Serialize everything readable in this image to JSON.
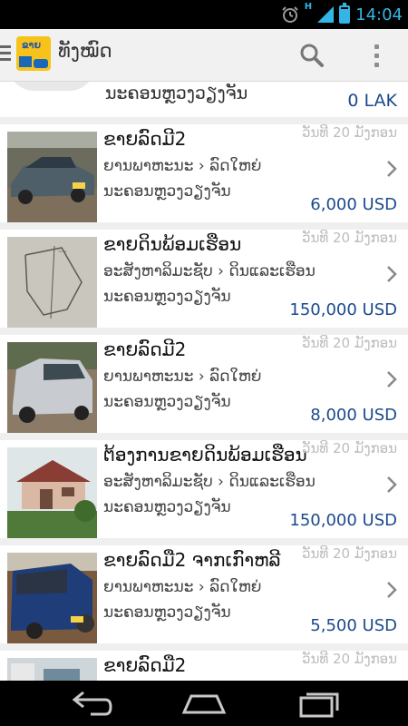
{
  "status_bar": {
    "time": "14:04",
    "network_label": "H",
    "battery_level": 0.85,
    "icons": [
      "alarm-icon",
      "signal-icon",
      "battery-icon"
    ]
  },
  "action_bar": {
    "logo_text": "ຂາຍ",
    "title": "ທັງໝົດ",
    "icons": [
      "hamburger-icon",
      "search-icon",
      "overflow-menu-icon"
    ]
  },
  "colors": {
    "accent": "#33b5e5",
    "price": "#1a4a8c",
    "date": "#bdbdbd",
    "background": "#efefef"
  },
  "partial_item": {
    "location": "ນະຄອນຫຼວງວຽງຈັນ",
    "price": "0 LAK"
  },
  "listings": [
    {
      "title": "ຂາຍລົດມີ2",
      "date": "ວັນທີ 20 ມັງກອນ",
      "category": "ຍານພາຫະນະ › ລົດໃຫຍ່",
      "location": "ນະຄອນຫຼວງວຽງຈັນ",
      "price": "6,000 USD",
      "thumb": "car-gray-sedan"
    },
    {
      "title": "ຂາຍດິນພ້ອມເຮືອນ",
      "date": "ວັນທີ 20 ມັງກອນ",
      "category": "ອະສັງຫາລິມະຊັບ › ດິນແລະເຮືອນ",
      "location": "ນະຄອນຫຼວງວຽງຈັນ",
      "price": "150,000 USD",
      "thumb": "land-map"
    },
    {
      "title": "ຂາຍລົດມີ2",
      "date": "ວັນທີ 20 ມັງກອນ",
      "category": "ຍານພາຫະນະ › ລົດໃຫຍ່",
      "location": "ນະຄອນຫຼວງວຽງຈັນ",
      "price": "8,000 USD",
      "thumb": "car-silver-hatch"
    },
    {
      "title": "ຕ້ອງການຂາຍດິນພ້ອມເຮືອນ",
      "date": "ວັນທີ 20 ມັງກອນ",
      "category": "ອະສັງຫາລິມະຊັບ › ດິນແລະເຮືອນ",
      "location": "ນະຄອນຫຼວງວຽງຈັນ",
      "price": "150,000 USD",
      "thumb": "house"
    },
    {
      "title": "ຂາຍລົດມື2 ຈາກເກົາຫລີ",
      "date": "ວັນທີ 20 ມັງກອນ",
      "category": "ຍານພາຫະນະ › ລົດໃຫຍ່",
      "location": "ນະຄອນຫຼວງວຽງຈັນ",
      "price": "5,500 USD",
      "thumb": "car-blue-suv"
    },
    {
      "title": "ຂາຍລົດມື2",
      "date": "ວັນທີ 20 ມັງກອນ",
      "category": "",
      "location": "",
      "price": "",
      "thumb": "buildings"
    }
  ],
  "nav_bar": {
    "icons": [
      "back-icon",
      "home-icon",
      "recent-apps-icon"
    ]
  }
}
